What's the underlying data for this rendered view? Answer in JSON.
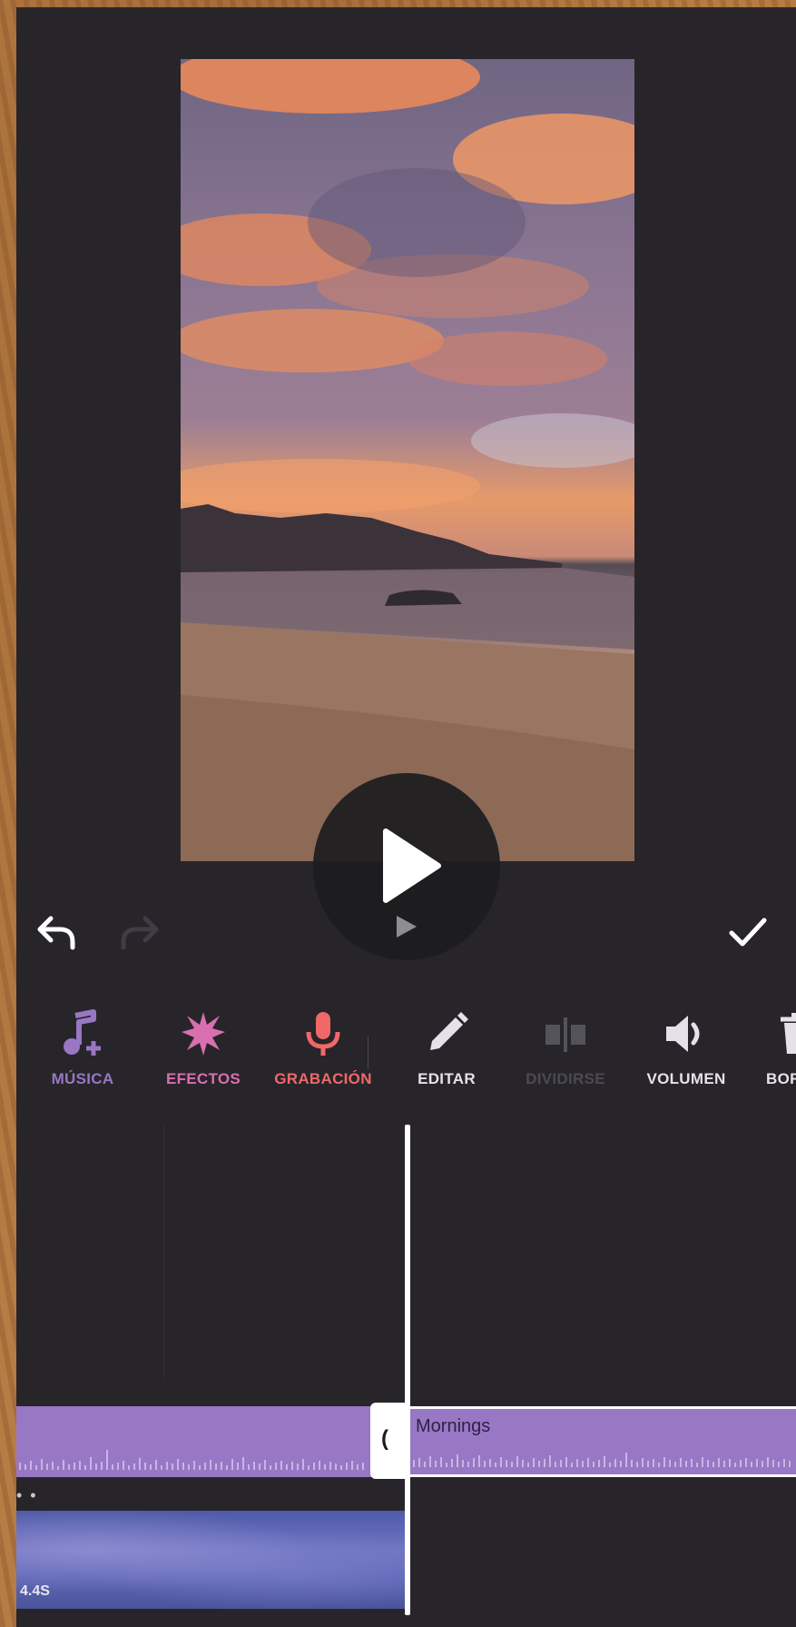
{
  "colors": {
    "background": "#27252a",
    "music_accent": "#9877c4",
    "effects_accent": "#d86fb0",
    "record_accent": "#f06868",
    "tool_label": "#e4e2e8",
    "disabled": "#55535a"
  },
  "player": {
    "play_icon": "play-icon",
    "undo_icon": "undo-icon",
    "redo_icon": "redo-icon",
    "confirm_icon": "check-icon"
  },
  "toolbar": {
    "items": [
      {
        "label": "MÚSICA",
        "icon": "music-add-icon"
      },
      {
        "label": "EFECTOS",
        "icon": "sparkle-icon"
      },
      {
        "label": "GRABACIÓN",
        "icon": "microphone-icon"
      },
      {
        "label": "EDITAR",
        "icon": "pencil-icon"
      },
      {
        "label": "DIVIDIRSE",
        "icon": "split-icon"
      },
      {
        "label": "VOLUMEN",
        "icon": "volume-icon"
      },
      {
        "label": "BORR",
        "icon": "trash-icon"
      }
    ]
  },
  "timeline": {
    "music_clip_name": "Mornings",
    "video_clip_time": "4.4S",
    "dots": "• •"
  }
}
